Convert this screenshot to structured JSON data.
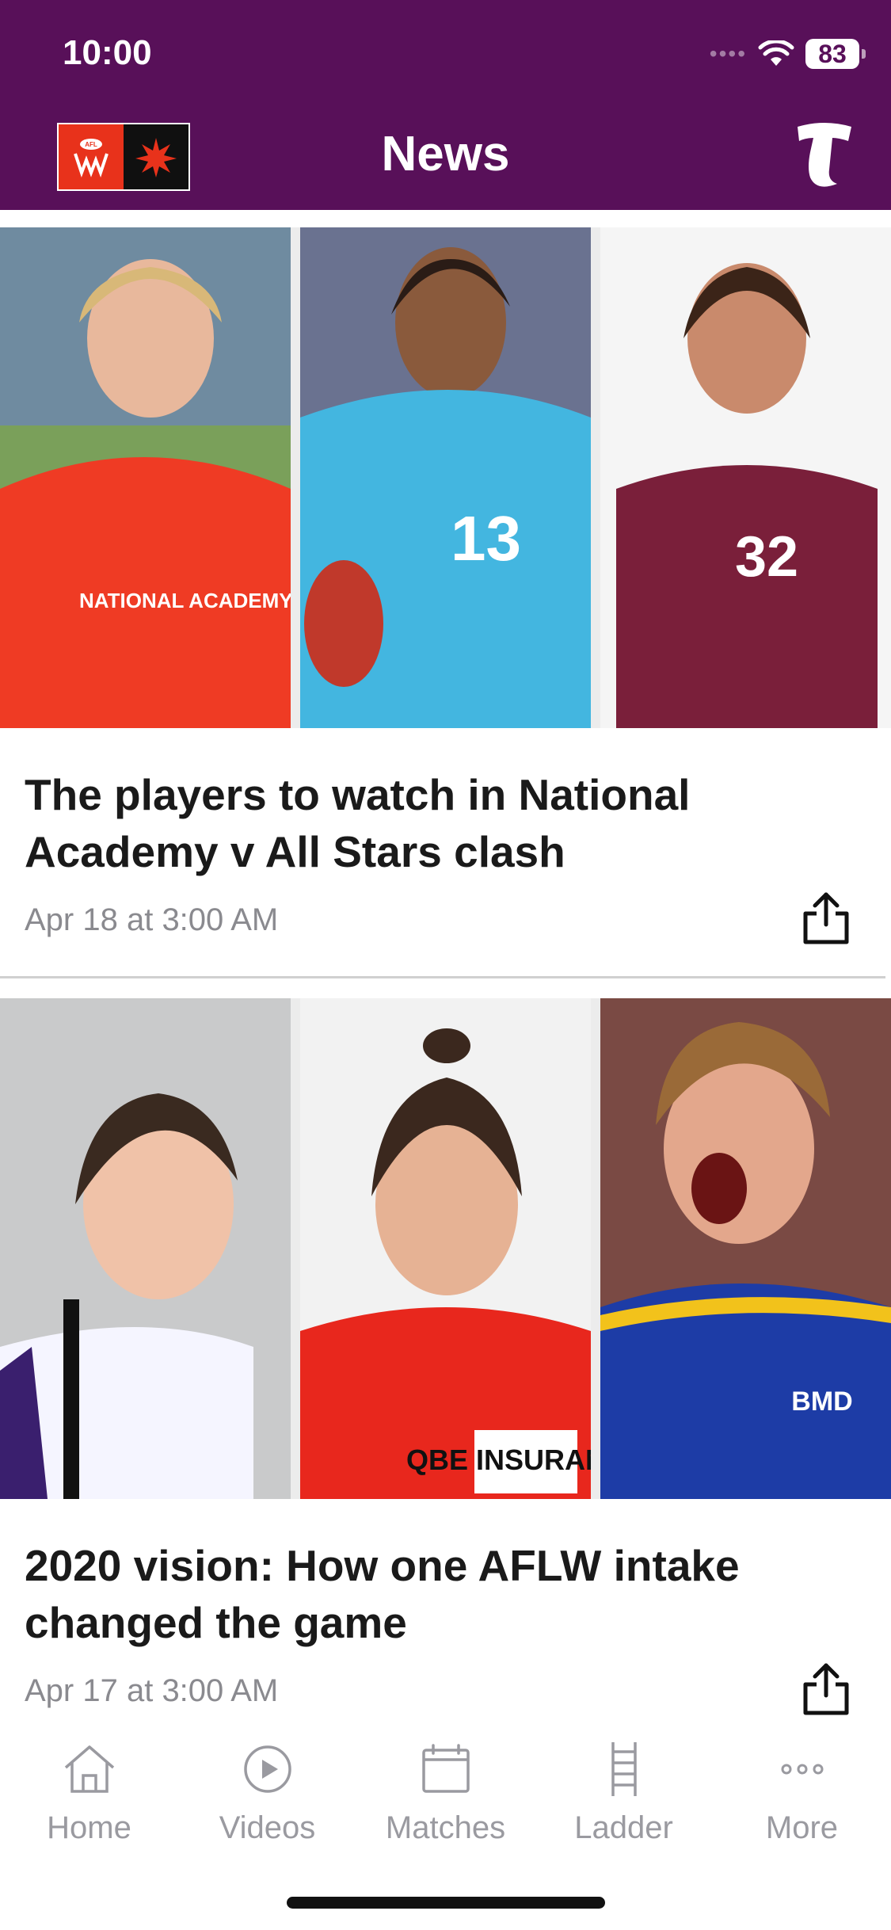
{
  "status_bar": {
    "time": "10:00",
    "battery": "83"
  },
  "header": {
    "title": "News",
    "logo_text": "AFLW"
  },
  "articles": [
    {
      "headline": "The players to watch in National Academy v All Stars clash",
      "date": "Apr 18 at 3:00 AM",
      "image_labels": [
        "NATIONAL ACADEMY",
        "13",
        "32"
      ]
    },
    {
      "headline": "2020 vision: How one AFLW intake changed the game",
      "date": "Apr 17 at 3:00 AM",
      "image_labels": [
        "",
        "QBE INSURANCE",
        "BMD"
      ]
    }
  ],
  "tab_bar": {
    "items": [
      {
        "label": "Home",
        "icon": "home-icon"
      },
      {
        "label": "Videos",
        "icon": "play-icon"
      },
      {
        "label": "Matches",
        "icon": "calendar-icon"
      },
      {
        "label": "Ladder",
        "icon": "ladder-icon"
      },
      {
        "label": "More",
        "icon": "more-icon"
      }
    ]
  },
  "colors": {
    "brand": "#581059",
    "accent": "#e8321b",
    "inactive": "#9a9aa0"
  }
}
